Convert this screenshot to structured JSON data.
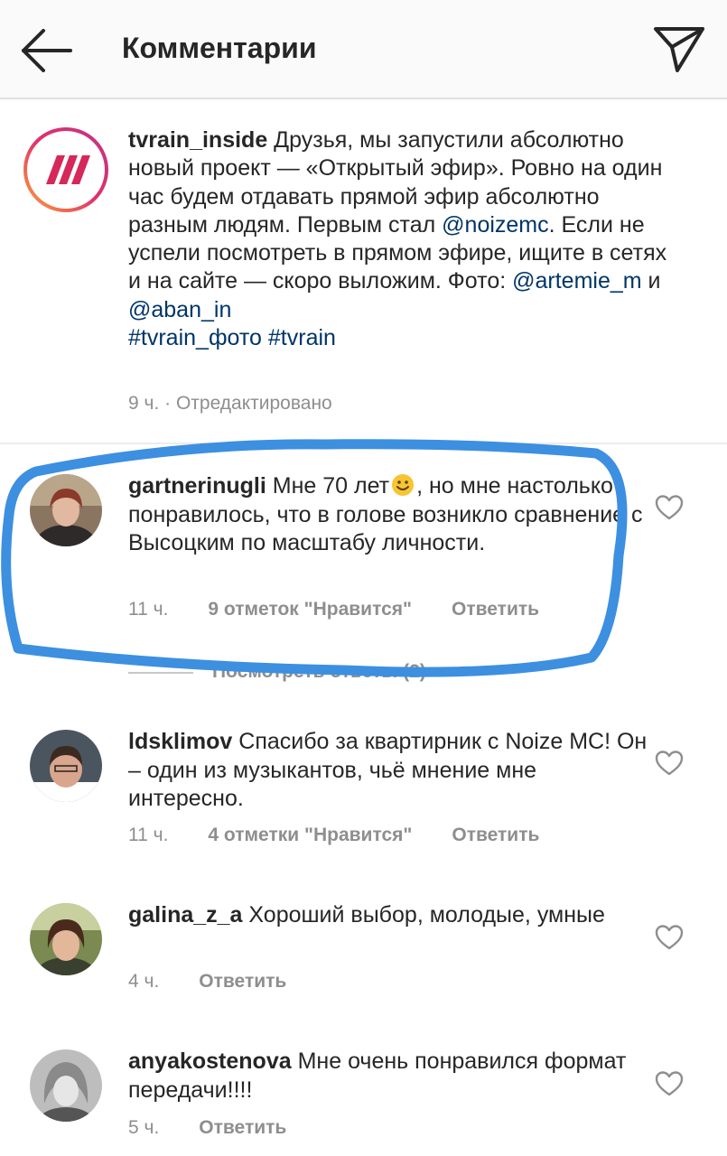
{
  "header": {
    "title": "Комментарии"
  },
  "caption": {
    "username": "tvrain_inside",
    "text_1": " Друзья, мы запустили абсолютно новый проект — «Открытый эфир». Ровно на один час будем отдавать прямой эфир абсолютно разным людям. Первым стал ",
    "mention_1": "@noizemc",
    "text_2": ". Если не успели посмотреть в прямом эфире, ищите в сетях и на сайте — скоро выложим. Фото: ",
    "mention_2": "@artemie_m",
    "text_3": " и ",
    "mention_3": "@aban_in",
    "hashtag_1": "#tvrain_фото",
    "hashtag_2": "#tvrain",
    "meta": "9 ч. · Отредактировано"
  },
  "comments": [
    {
      "username": "gartnerinugli",
      "text_a": " Мне 70 лет",
      "text_b": ", но мне настолько понравилось, что в голове возникло сравнение с Высоцким по масштабу личности.",
      "time": "11 ч.",
      "likes": "9 отметок \"Нравится\"",
      "reply": "Ответить",
      "view_replies": "Посмотреть ответы (2)"
    },
    {
      "username": "ldsklimov",
      "text": " Спасибо за квартирник с Noize MC! Он – один из музыкантов, чьё мнение мне интересно.",
      "time": "11 ч.",
      "likes": "4 отметки \"Нравится\"",
      "reply": "Ответить"
    },
    {
      "username": "galina_z_a",
      "text": " Хороший выбор, молодые, умные",
      "time": "4 ч.",
      "reply": "Ответить"
    },
    {
      "username": "anyakostenova",
      "text": " Мне очень понравился формат передачи!!!!",
      "time": "5 ч.",
      "reply": "Ответить"
    }
  ],
  "colors": {
    "link": "#003569",
    "highlight": "#3d8fe0",
    "muted": "#8e8e8e"
  },
  "icons": [
    "back-arrow-icon",
    "send-icon",
    "heart-icon",
    "smile-emoji-icon"
  ]
}
